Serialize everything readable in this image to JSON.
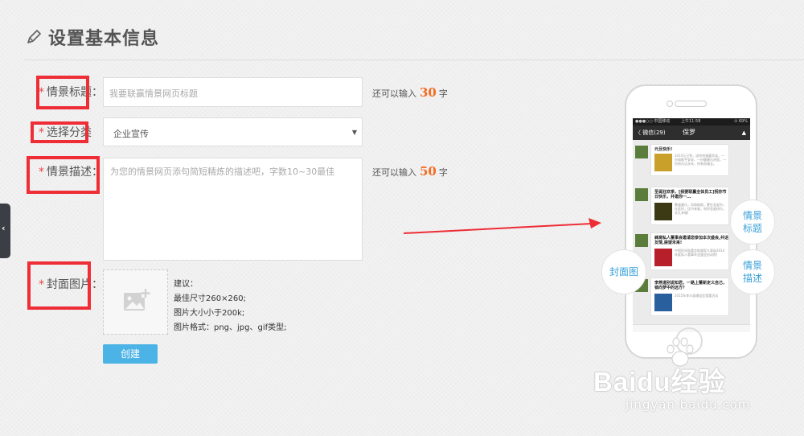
{
  "header": {
    "title": "设置基本信息"
  },
  "form": {
    "title_field": {
      "required_mark": "*",
      "label": "情景标题：",
      "placeholder": "我要联赢情景网页标题",
      "counter_prefix": "还可以输入",
      "counter_value": "30",
      "counter_suffix": "字"
    },
    "category_field": {
      "required_mark": "*",
      "label": "选择分类",
      "selected": "企业宣传"
    },
    "description_field": {
      "required_mark": "*",
      "label": "情景描述：",
      "placeholder": "为您的情景网页添句简短精炼的描述吧，字数10~30最佳",
      "counter_prefix": "还可以输入",
      "counter_value": "50",
      "counter_suffix": "字"
    },
    "cover_field": {
      "required_mark": "*",
      "label": "封面图片："
    },
    "cover_hints": [
      "建议：",
      "最佳尺寸260×260;",
      "图片大小小于200k;",
      "图片格式：png、jpg、gif类型;"
    ],
    "submit_label": "创建"
  },
  "phone": {
    "status_carrier": "●●●○○ 中国移动",
    "status_time": "上午11:58",
    "status_battery": "⊙ 69%",
    "nav_back": "〈 微信(29)",
    "nav_title": "保罗",
    "messages": [
      {
        "title": "元旦快乐!",
        "body": "2015元旦到，送你祝福要你笑，一份和睦平安安，一份健康乐逍遥，一份快乐达永年，所有祝福全。"
      },
      {
        "title": "圣诞狂欢季，[我要联赢全体员工]祝你节日快乐，并邀你一...",
        "body": "繁盛美乐，风和韵韵，蒙在圣诞节，在此时，佳节来临，祝你圣诞快乐，长久幸福!"
      },
      {
        "title": "蜂窝私人董事会邀请您参加本次盛会,共话友情,展望未来!",
        "body": "中国民间私董会联盟家大革族2014年度私人董事年会盛会启动啦!"
      },
      {
        "title": "李燕道别说知君，一路上董新定义自己，锁向梦中的远方？",
        "body": "2015年李众道通组会我董活动"
      }
    ],
    "callouts": {
      "title": "情景\n标题",
      "cover": "封面图",
      "description": "情景\n描述"
    }
  },
  "watermark": {
    "brand": "Baidu经验",
    "url": "jingyan.baidu.com"
  },
  "colors": {
    "required": "#ee2d36",
    "counter": "#f36c21",
    "button": "#4cb3e6",
    "callout_text": "#3aa0d8"
  }
}
